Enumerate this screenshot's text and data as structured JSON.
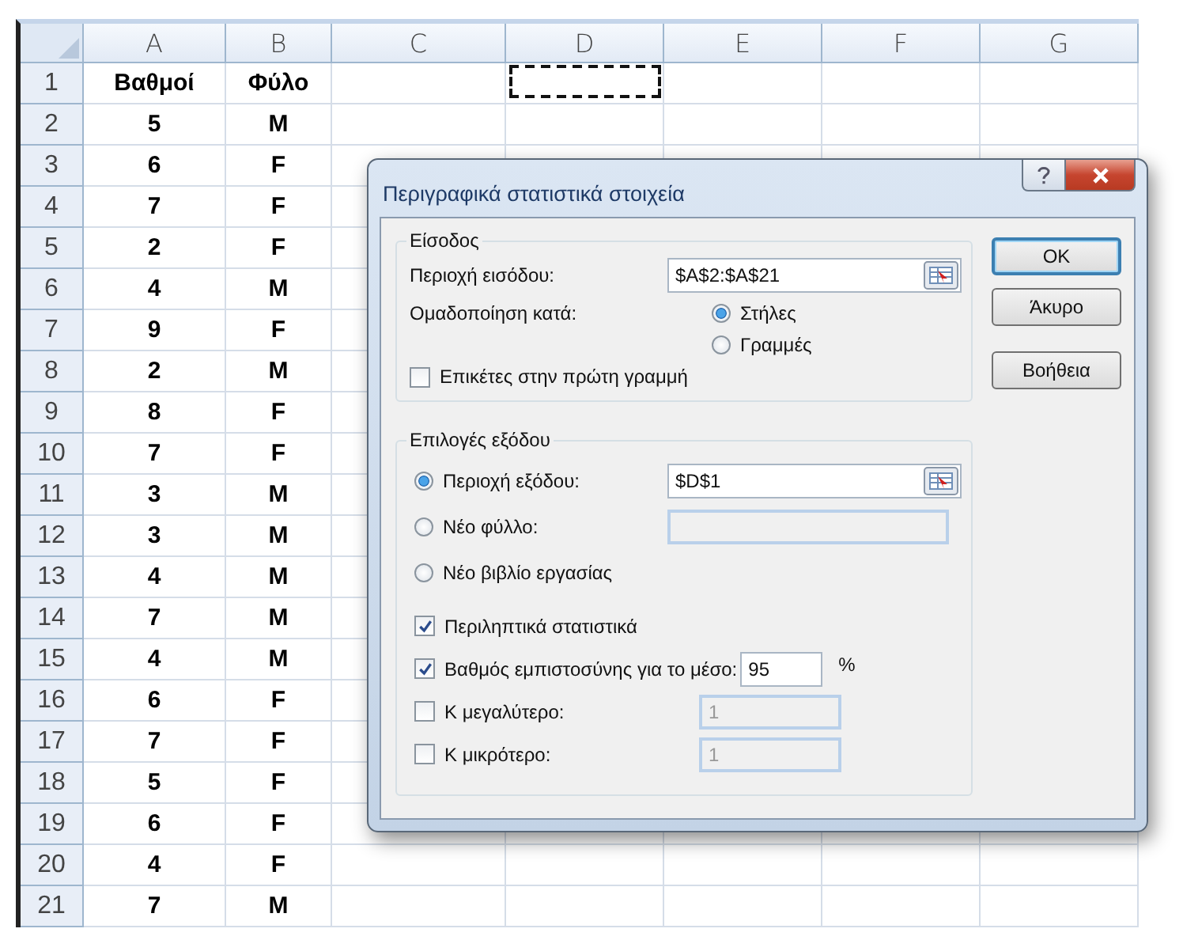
{
  "sheet": {
    "columns": [
      "A",
      "B",
      "C",
      "D",
      "E",
      "F",
      "G"
    ],
    "rows": [
      {
        "number": "1",
        "cells": [
          {
            "text": "Βαθμοί",
            "marquee": false
          },
          {
            "text": "Φύλο",
            "marquee": false
          },
          {
            "marquee": false
          },
          {
            "marquee": true
          }
        ]
      },
      {
        "number": "2",
        "cells": [
          {
            "text": "5"
          },
          {
            "text": "M"
          }
        ]
      },
      {
        "number": "3",
        "cells": [
          {
            "text": "6"
          },
          {
            "text": "F"
          }
        ]
      },
      {
        "number": "4",
        "cells": [
          {
            "text": "7"
          },
          {
            "text": "F"
          }
        ]
      },
      {
        "number": "5",
        "cells": [
          {
            "text": "2"
          },
          {
            "text": "F"
          }
        ]
      },
      {
        "number": "6",
        "cells": [
          {
            "text": "4"
          },
          {
            "text": "M"
          }
        ]
      },
      {
        "number": "7",
        "cells": [
          {
            "text": "9"
          },
          {
            "text": "F"
          }
        ]
      },
      {
        "number": "8",
        "cells": [
          {
            "text": "2"
          },
          {
            "text": "M"
          }
        ]
      },
      {
        "number": "9",
        "cells": [
          {
            "text": "8"
          },
          {
            "text": "F"
          }
        ]
      },
      {
        "number": "10",
        "cells": [
          {
            "text": "7"
          },
          {
            "text": "F"
          }
        ]
      },
      {
        "number": "11",
        "cells": [
          {
            "text": "3"
          },
          {
            "text": "M"
          }
        ]
      },
      {
        "number": "12",
        "cells": [
          {
            "text": "3"
          },
          {
            "text": "M"
          }
        ]
      },
      {
        "number": "13",
        "cells": [
          {
            "text": "4"
          },
          {
            "text": "M"
          }
        ]
      },
      {
        "number": "14",
        "cells": [
          {
            "text": "7"
          },
          {
            "text": "M"
          }
        ]
      },
      {
        "number": "15",
        "cells": [
          {
            "text": "4"
          },
          {
            "text": "M"
          }
        ]
      },
      {
        "number": "16",
        "cells": [
          {
            "text": "6"
          },
          {
            "text": "F"
          }
        ]
      },
      {
        "number": "17",
        "cells": [
          {
            "text": "7"
          },
          {
            "text": "F"
          }
        ]
      },
      {
        "number": "18",
        "cells": [
          {
            "text": "5"
          },
          {
            "text": "F"
          }
        ]
      },
      {
        "number": "19",
        "cells": [
          {
            "text": "6"
          },
          {
            "text": "F"
          }
        ]
      },
      {
        "number": "20",
        "cells": [
          {
            "text": "4"
          },
          {
            "text": "F"
          }
        ]
      },
      {
        "number": "21",
        "cells": [
          {
            "text": "7"
          },
          {
            "text": "M"
          }
        ]
      }
    ]
  },
  "dialog": {
    "title": "Περιγραφικά στατιστικά στοιχεία",
    "input": {
      "title": "Είσοδος",
      "range_label": "Περιοχή εισόδου:",
      "range_value": "$A$2:$A$21",
      "grouped_label": "Ομαδοποίηση κατά:",
      "grouped_options": [
        {
          "label": "Στήλες",
          "selected": true
        },
        {
          "label": "Γραμμές",
          "selected": false
        }
      ],
      "labels_checkbox": {
        "label": "Επικέτες στην πρώτη γραμμή",
        "checked": false
      }
    },
    "output": {
      "title": "Επιλογές εξόδου",
      "options": [
        {
          "kind": "range",
          "label": "Περιοχή εξόδου:",
          "selected": true,
          "value": "$D$1"
        },
        {
          "kind": "field",
          "label": "Νέο φύλλο:",
          "selected": false
        },
        {
          "kind": "plain",
          "label": "Νέο βιβλίο εργασίας",
          "selected": false
        }
      ],
      "checks": [
        {
          "kind": "plain",
          "label": "Περιληπτικά στατιστικά",
          "checked": true
        },
        {
          "kind": "percent",
          "label": "Βαθμός εμπιστοσύνης για το μέσο:",
          "checked": true,
          "value": "95",
          "suffix": "%"
        },
        {
          "kind": "number",
          "label": "Κ μεγαλύτερο:",
          "checked": false,
          "value": "1"
        },
        {
          "kind": "number",
          "label": "Κ μικρότερο:",
          "checked": false,
          "value": "1"
        }
      ]
    },
    "buttons": [
      {
        "label": "OK",
        "default": true
      },
      {
        "label": "Άκυρο",
        "default": false
      },
      {
        "label": "Βοήθεια",
        "default": false
      }
    ]
  }
}
